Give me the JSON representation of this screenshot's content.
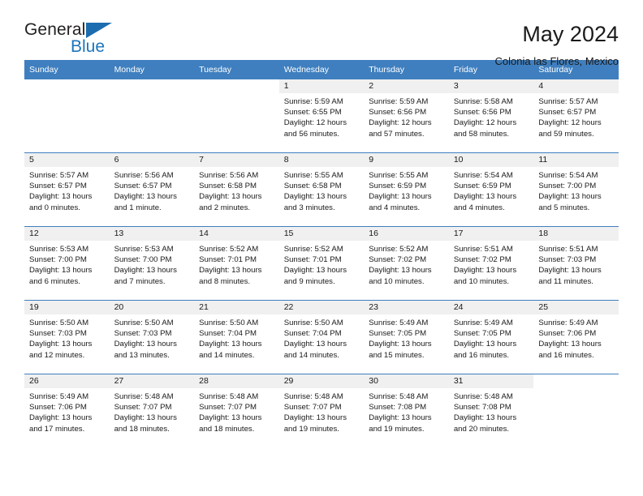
{
  "brand": {
    "name_top": "General",
    "name_bottom": "Blue",
    "triangle_color": "#1c6cb0",
    "blue_color": "#1c75bc"
  },
  "header": {
    "title": "May 2024",
    "subtitle": "Colonia las Flores, Mexico"
  },
  "theme": {
    "header_blue": "#3f7fbf",
    "band_gray": "#f0f0f0"
  },
  "weekday_headers": [
    "Sunday",
    "Monday",
    "Tuesday",
    "Wednesday",
    "Thursday",
    "Friday",
    "Saturday"
  ],
  "labels": {
    "sunrise_prefix": "Sunrise:",
    "sunset_prefix": "Sunset:",
    "daylight_prefix": "Daylight:"
  },
  "weeks": [
    [
      {
        "day": "",
        "blank": true,
        "line1": "",
        "line2": "",
        "line3": "",
        "line4": ""
      },
      {
        "day": "",
        "blank": true,
        "line1": "",
        "line2": "",
        "line3": "",
        "line4": ""
      },
      {
        "day": "",
        "blank": true,
        "line1": "",
        "line2": "",
        "line3": "",
        "line4": ""
      },
      {
        "day": "1",
        "line1": "Sunrise: 5:59 AM",
        "line2": "Sunset: 6:55 PM",
        "line3": "Daylight: 12 hours",
        "line4": "and 56 minutes."
      },
      {
        "day": "2",
        "line1": "Sunrise: 5:59 AM",
        "line2": "Sunset: 6:56 PM",
        "line3": "Daylight: 12 hours",
        "line4": "and 57 minutes."
      },
      {
        "day": "3",
        "line1": "Sunrise: 5:58 AM",
        "line2": "Sunset: 6:56 PM",
        "line3": "Daylight: 12 hours",
        "line4": "and 58 minutes."
      },
      {
        "day": "4",
        "line1": "Sunrise: 5:57 AM",
        "line2": "Sunset: 6:57 PM",
        "line3": "Daylight: 12 hours",
        "line4": "and 59 minutes."
      }
    ],
    [
      {
        "day": "5",
        "line1": "Sunrise: 5:57 AM",
        "line2": "Sunset: 6:57 PM",
        "line3": "Daylight: 13 hours",
        "line4": "and 0 minutes."
      },
      {
        "day": "6",
        "line1": "Sunrise: 5:56 AM",
        "line2": "Sunset: 6:57 PM",
        "line3": "Daylight: 13 hours",
        "line4": "and 1 minute."
      },
      {
        "day": "7",
        "line1": "Sunrise: 5:56 AM",
        "line2": "Sunset: 6:58 PM",
        "line3": "Daylight: 13 hours",
        "line4": "and 2 minutes."
      },
      {
        "day": "8",
        "line1": "Sunrise: 5:55 AM",
        "line2": "Sunset: 6:58 PM",
        "line3": "Daylight: 13 hours",
        "line4": "and 3 minutes."
      },
      {
        "day": "9",
        "line1": "Sunrise: 5:55 AM",
        "line2": "Sunset: 6:59 PM",
        "line3": "Daylight: 13 hours",
        "line4": "and 4 minutes."
      },
      {
        "day": "10",
        "line1": "Sunrise: 5:54 AM",
        "line2": "Sunset: 6:59 PM",
        "line3": "Daylight: 13 hours",
        "line4": "and 4 minutes."
      },
      {
        "day": "11",
        "line1": "Sunrise: 5:54 AM",
        "line2": "Sunset: 7:00 PM",
        "line3": "Daylight: 13 hours",
        "line4": "and 5 minutes."
      }
    ],
    [
      {
        "day": "12",
        "line1": "Sunrise: 5:53 AM",
        "line2": "Sunset: 7:00 PM",
        "line3": "Daylight: 13 hours",
        "line4": "and 6 minutes."
      },
      {
        "day": "13",
        "line1": "Sunrise: 5:53 AM",
        "line2": "Sunset: 7:00 PM",
        "line3": "Daylight: 13 hours",
        "line4": "and 7 minutes."
      },
      {
        "day": "14",
        "line1": "Sunrise: 5:52 AM",
        "line2": "Sunset: 7:01 PM",
        "line3": "Daylight: 13 hours",
        "line4": "and 8 minutes."
      },
      {
        "day": "15",
        "line1": "Sunrise: 5:52 AM",
        "line2": "Sunset: 7:01 PM",
        "line3": "Daylight: 13 hours",
        "line4": "and 9 minutes."
      },
      {
        "day": "16",
        "line1": "Sunrise: 5:52 AM",
        "line2": "Sunset: 7:02 PM",
        "line3": "Daylight: 13 hours",
        "line4": "and 10 minutes."
      },
      {
        "day": "17",
        "line1": "Sunrise: 5:51 AM",
        "line2": "Sunset: 7:02 PM",
        "line3": "Daylight: 13 hours",
        "line4": "and 10 minutes."
      },
      {
        "day": "18",
        "line1": "Sunrise: 5:51 AM",
        "line2": "Sunset: 7:03 PM",
        "line3": "Daylight: 13 hours",
        "line4": "and 11 minutes."
      }
    ],
    [
      {
        "day": "19",
        "line1": "Sunrise: 5:50 AM",
        "line2": "Sunset: 7:03 PM",
        "line3": "Daylight: 13 hours",
        "line4": "and 12 minutes."
      },
      {
        "day": "20",
        "line1": "Sunrise: 5:50 AM",
        "line2": "Sunset: 7:03 PM",
        "line3": "Daylight: 13 hours",
        "line4": "and 13 minutes."
      },
      {
        "day": "21",
        "line1": "Sunrise: 5:50 AM",
        "line2": "Sunset: 7:04 PM",
        "line3": "Daylight: 13 hours",
        "line4": "and 14 minutes."
      },
      {
        "day": "22",
        "line1": "Sunrise: 5:50 AM",
        "line2": "Sunset: 7:04 PM",
        "line3": "Daylight: 13 hours",
        "line4": "and 14 minutes."
      },
      {
        "day": "23",
        "line1": "Sunrise: 5:49 AM",
        "line2": "Sunset: 7:05 PM",
        "line3": "Daylight: 13 hours",
        "line4": "and 15 minutes."
      },
      {
        "day": "24",
        "line1": "Sunrise: 5:49 AM",
        "line2": "Sunset: 7:05 PM",
        "line3": "Daylight: 13 hours",
        "line4": "and 16 minutes."
      },
      {
        "day": "25",
        "line1": "Sunrise: 5:49 AM",
        "line2": "Sunset: 7:06 PM",
        "line3": "Daylight: 13 hours",
        "line4": "and 16 minutes."
      }
    ],
    [
      {
        "day": "26",
        "line1": "Sunrise: 5:49 AM",
        "line2": "Sunset: 7:06 PM",
        "line3": "Daylight: 13 hours",
        "line4": "and 17 minutes."
      },
      {
        "day": "27",
        "line1": "Sunrise: 5:48 AM",
        "line2": "Sunset: 7:07 PM",
        "line3": "Daylight: 13 hours",
        "line4": "and 18 minutes."
      },
      {
        "day": "28",
        "line1": "Sunrise: 5:48 AM",
        "line2": "Sunset: 7:07 PM",
        "line3": "Daylight: 13 hours",
        "line4": "and 18 minutes."
      },
      {
        "day": "29",
        "line1": "Sunrise: 5:48 AM",
        "line2": "Sunset: 7:07 PM",
        "line3": "Daylight: 13 hours",
        "line4": "and 19 minutes."
      },
      {
        "day": "30",
        "line1": "Sunrise: 5:48 AM",
        "line2": "Sunset: 7:08 PM",
        "line3": "Daylight: 13 hours",
        "line4": "and 19 minutes."
      },
      {
        "day": "31",
        "line1": "Sunrise: 5:48 AM",
        "line2": "Sunset: 7:08 PM",
        "line3": "Daylight: 13 hours",
        "line4": "and 20 minutes."
      },
      {
        "day": "",
        "blank": true,
        "line1": "",
        "line2": "",
        "line3": "",
        "line4": ""
      }
    ]
  ]
}
